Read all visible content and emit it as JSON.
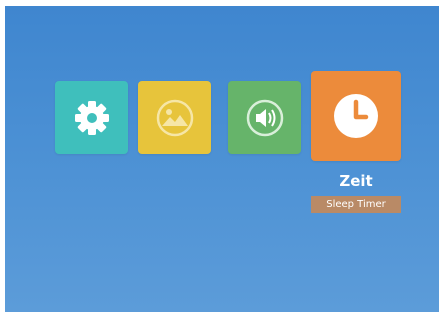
{
  "menu": {
    "items": [
      {
        "id": "settings",
        "icon": "gear-icon",
        "color": "#3fbfbc"
      },
      {
        "id": "picture",
        "icon": "picture-icon",
        "color": "#e7c43b"
      },
      {
        "id": "sound",
        "icon": "speaker-icon",
        "color": "#66b46a"
      },
      {
        "id": "time",
        "icon": "clock-icon",
        "color": "#ec8b3b",
        "selected": true
      }
    ],
    "selected_title": "Zeit",
    "selected_subtitle": "Sleep Timer"
  },
  "colors": {
    "background_top": "#3f86cf",
    "background_bottom": "#5c9cd9",
    "subtitle_bg": "#b98a66"
  }
}
